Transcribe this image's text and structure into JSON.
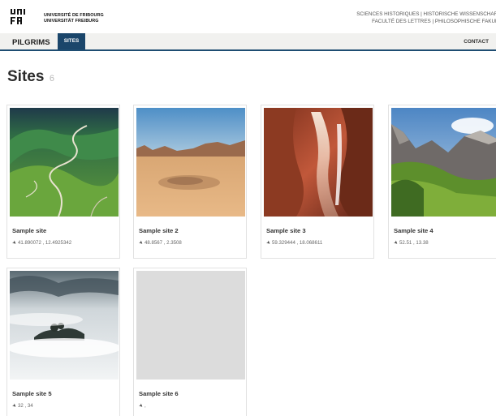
{
  "header": {
    "logo_text": "UNI FR",
    "university_name_fr": "UNIVERSITÉ DE FRIBOURG",
    "university_name_de": "UNIVERSITÄT FREIBURG",
    "department_line1": "SCIENCES HISTORIQUES | HISTORISCHE WISSENSCHAFTEN",
    "faculty_line2": "FACULTÉ DES LETTRES | PHILOSOPHISCHE FAKULTÄT"
  },
  "nav": {
    "brand": "PILGRIMS",
    "active_tab": "SITES",
    "contact": "CONTACT"
  },
  "page": {
    "title": "Sites",
    "count": "6"
  },
  "sites": [
    {
      "title": "Sample site",
      "coords": "41.890072 , 12.4925342",
      "image": "winding-mountain-road"
    },
    {
      "title": "Sample site 2",
      "coords": "48.8567 , 2.3508",
      "image": "desert"
    },
    {
      "title": "Sample site 3",
      "coords": "59.329444 , 18.068611",
      "image": "slot-canyon"
    },
    {
      "title": "Sample site 4",
      "coords": "52.51 , 13.38",
      "image": "alpine-valley"
    },
    {
      "title": "Sample site 5",
      "coords": "32 , 34",
      "image": "misty-hills"
    },
    {
      "title": "Sample site 6",
      "coords": ",",
      "image": "placeholder"
    }
  ],
  "icons": {
    "coordinate": "location-arrow-icon"
  },
  "colors": {
    "nav_active_bg": "#1b466b",
    "nav_bg": "#f1f1ef",
    "nav_border": "#1e4d72"
  }
}
